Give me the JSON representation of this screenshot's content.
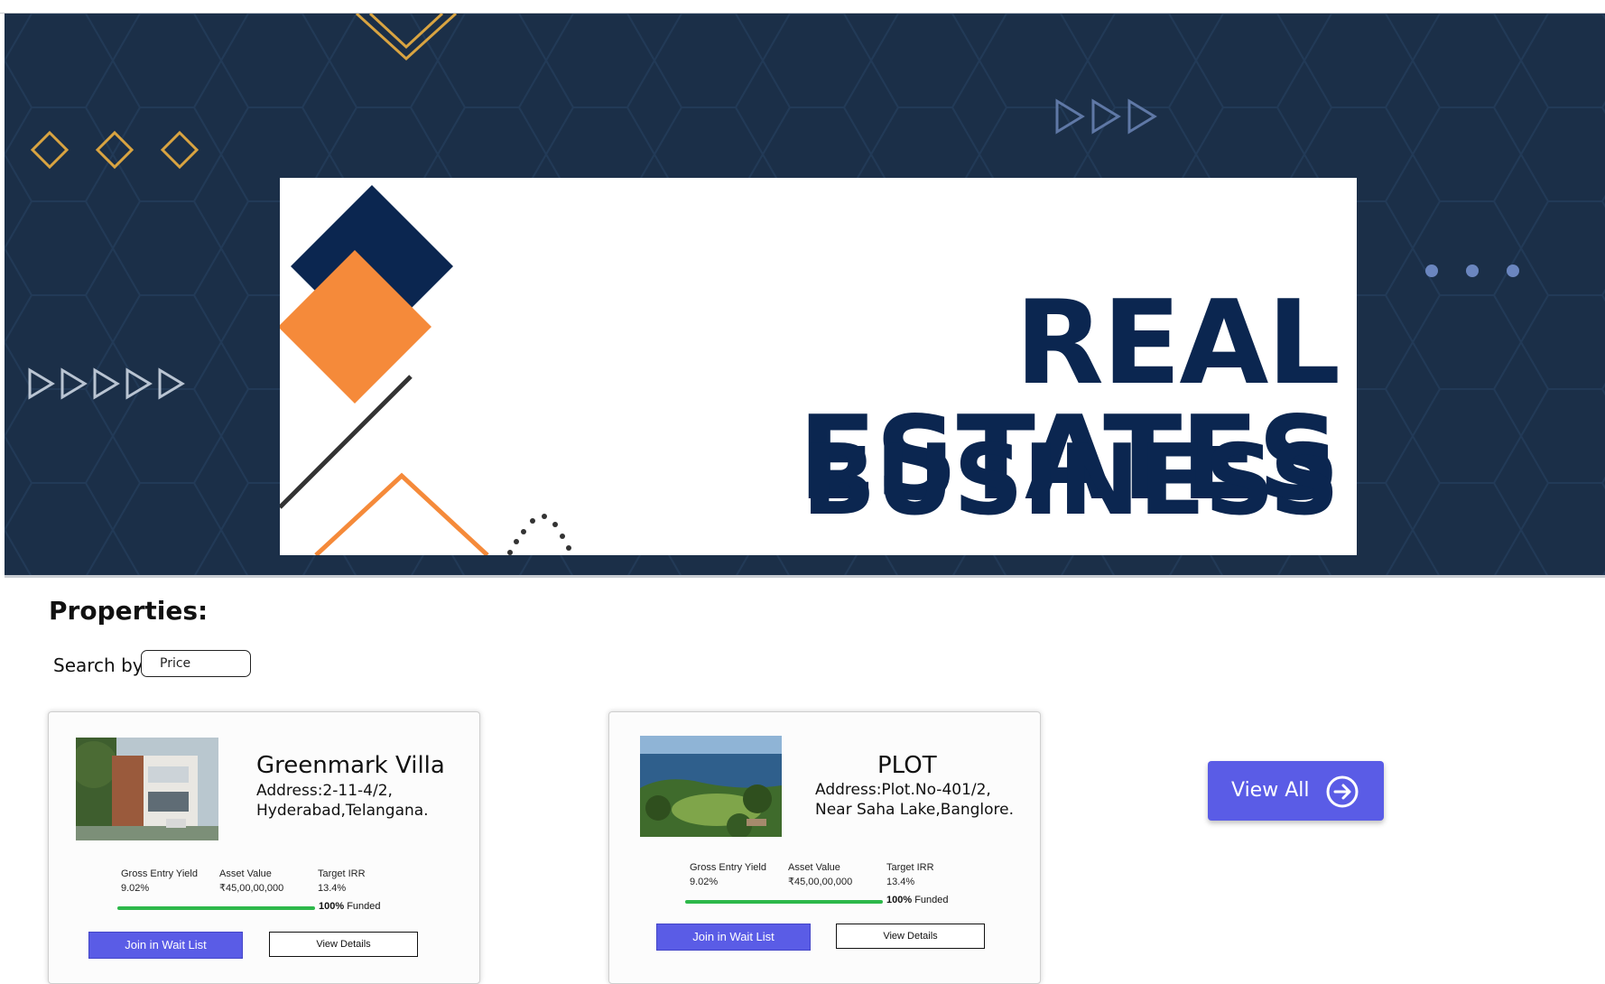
{
  "banner": {
    "title": "REAL ESTATES",
    "subtitle": "BUSINESS"
  },
  "section": {
    "title": "Properties:"
  },
  "search": {
    "label": "Search by :",
    "value": "Price"
  },
  "properties": [
    {
      "name": "Greenmark Villa",
      "address_line1": "Address:2-11-4/2,",
      "address_line2": "Hyderabad,Telangana.",
      "gross_entry_yield_label": "Gross Entry Yield",
      "gross_entry_yield": "9.02%",
      "asset_value_label": "Asset Value",
      "asset_value": "₹45,00,00,000",
      "target_irr_label": "Target IRR",
      "target_irr": "13.4%",
      "funded_percent": "100%",
      "funded_label": "Funded",
      "funded_fraction": 1.0,
      "join_label": "Join in Wait List",
      "details_label": "View Details"
    },
    {
      "name": "PLOT",
      "address_line1": "Address:Plot.No-401/2,",
      "address_line2": "Near Saha Lake,Banglore.",
      "gross_entry_yield_label": "Gross Entry Yield",
      "gross_entry_yield": "9.02%",
      "asset_value_label": "Asset Value",
      "asset_value": "₹45,00,00,000",
      "target_irr_label": "Target IRR",
      "target_irr": "13.4%",
      "funded_percent": "100%",
      "funded_label": "Funded",
      "funded_fraction": 1.0,
      "join_label": "Join in Wait List",
      "details_label": "View Details"
    }
  ],
  "view_all": {
    "label": "View All",
    "icon": "arrow-right-circle-icon"
  },
  "colors": {
    "hero_bg": "#1b2f48",
    "navy": "#0b2650",
    "orange": "#f58a3a",
    "gold": "#d9a441",
    "primary_button": "#5a5ce6",
    "progress": "#2db84a"
  }
}
